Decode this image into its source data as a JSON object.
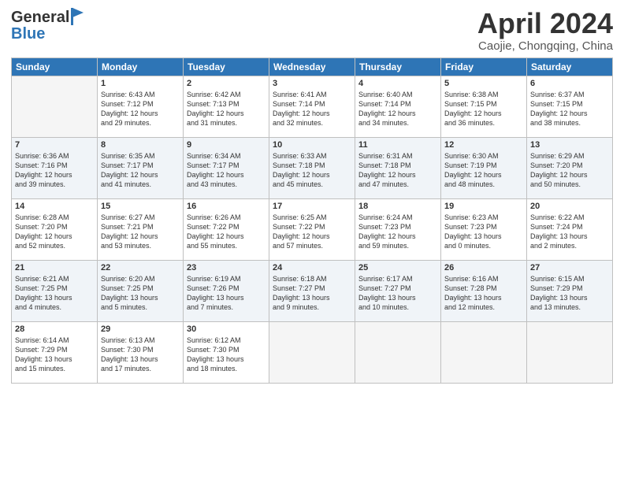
{
  "header": {
    "logo_line1": "General",
    "logo_line2": "Blue",
    "title": "April 2024",
    "subtitle": "Caojie, Chongqing, China"
  },
  "columns": [
    "Sunday",
    "Monday",
    "Tuesday",
    "Wednesday",
    "Thursday",
    "Friday",
    "Saturday"
  ],
  "weeks": [
    {
      "days": [
        {
          "num": "",
          "info": ""
        },
        {
          "num": "1",
          "info": "Sunrise: 6:43 AM\nSunset: 7:12 PM\nDaylight: 12 hours\nand 29 minutes."
        },
        {
          "num": "2",
          "info": "Sunrise: 6:42 AM\nSunset: 7:13 PM\nDaylight: 12 hours\nand 31 minutes."
        },
        {
          "num": "3",
          "info": "Sunrise: 6:41 AM\nSunset: 7:14 PM\nDaylight: 12 hours\nand 32 minutes."
        },
        {
          "num": "4",
          "info": "Sunrise: 6:40 AM\nSunset: 7:14 PM\nDaylight: 12 hours\nand 34 minutes."
        },
        {
          "num": "5",
          "info": "Sunrise: 6:38 AM\nSunset: 7:15 PM\nDaylight: 12 hours\nand 36 minutes."
        },
        {
          "num": "6",
          "info": "Sunrise: 6:37 AM\nSunset: 7:15 PM\nDaylight: 12 hours\nand 38 minutes."
        }
      ]
    },
    {
      "days": [
        {
          "num": "7",
          "info": "Sunrise: 6:36 AM\nSunset: 7:16 PM\nDaylight: 12 hours\nand 39 minutes."
        },
        {
          "num": "8",
          "info": "Sunrise: 6:35 AM\nSunset: 7:17 PM\nDaylight: 12 hours\nand 41 minutes."
        },
        {
          "num": "9",
          "info": "Sunrise: 6:34 AM\nSunset: 7:17 PM\nDaylight: 12 hours\nand 43 minutes."
        },
        {
          "num": "10",
          "info": "Sunrise: 6:33 AM\nSunset: 7:18 PM\nDaylight: 12 hours\nand 45 minutes."
        },
        {
          "num": "11",
          "info": "Sunrise: 6:31 AM\nSunset: 7:18 PM\nDaylight: 12 hours\nand 47 minutes."
        },
        {
          "num": "12",
          "info": "Sunrise: 6:30 AM\nSunset: 7:19 PM\nDaylight: 12 hours\nand 48 minutes."
        },
        {
          "num": "13",
          "info": "Sunrise: 6:29 AM\nSunset: 7:20 PM\nDaylight: 12 hours\nand 50 minutes."
        }
      ]
    },
    {
      "days": [
        {
          "num": "14",
          "info": "Sunrise: 6:28 AM\nSunset: 7:20 PM\nDaylight: 12 hours\nand 52 minutes."
        },
        {
          "num": "15",
          "info": "Sunrise: 6:27 AM\nSunset: 7:21 PM\nDaylight: 12 hours\nand 53 minutes."
        },
        {
          "num": "16",
          "info": "Sunrise: 6:26 AM\nSunset: 7:22 PM\nDaylight: 12 hours\nand 55 minutes."
        },
        {
          "num": "17",
          "info": "Sunrise: 6:25 AM\nSunset: 7:22 PM\nDaylight: 12 hours\nand 57 minutes."
        },
        {
          "num": "18",
          "info": "Sunrise: 6:24 AM\nSunset: 7:23 PM\nDaylight: 12 hours\nand 59 minutes."
        },
        {
          "num": "19",
          "info": "Sunrise: 6:23 AM\nSunset: 7:23 PM\nDaylight: 13 hours\nand 0 minutes."
        },
        {
          "num": "20",
          "info": "Sunrise: 6:22 AM\nSunset: 7:24 PM\nDaylight: 13 hours\nand 2 minutes."
        }
      ]
    },
    {
      "days": [
        {
          "num": "21",
          "info": "Sunrise: 6:21 AM\nSunset: 7:25 PM\nDaylight: 13 hours\nand 4 minutes."
        },
        {
          "num": "22",
          "info": "Sunrise: 6:20 AM\nSunset: 7:25 PM\nDaylight: 13 hours\nand 5 minutes."
        },
        {
          "num": "23",
          "info": "Sunrise: 6:19 AM\nSunset: 7:26 PM\nDaylight: 13 hours\nand 7 minutes."
        },
        {
          "num": "24",
          "info": "Sunrise: 6:18 AM\nSunset: 7:27 PM\nDaylight: 13 hours\nand 9 minutes."
        },
        {
          "num": "25",
          "info": "Sunrise: 6:17 AM\nSunset: 7:27 PM\nDaylight: 13 hours\nand 10 minutes."
        },
        {
          "num": "26",
          "info": "Sunrise: 6:16 AM\nSunset: 7:28 PM\nDaylight: 13 hours\nand 12 minutes."
        },
        {
          "num": "27",
          "info": "Sunrise: 6:15 AM\nSunset: 7:29 PM\nDaylight: 13 hours\nand 13 minutes."
        }
      ]
    },
    {
      "days": [
        {
          "num": "28",
          "info": "Sunrise: 6:14 AM\nSunset: 7:29 PM\nDaylight: 13 hours\nand 15 minutes."
        },
        {
          "num": "29",
          "info": "Sunrise: 6:13 AM\nSunset: 7:30 PM\nDaylight: 13 hours\nand 17 minutes."
        },
        {
          "num": "30",
          "info": "Sunrise: 6:12 AM\nSunset: 7:30 PM\nDaylight: 13 hours\nand 18 minutes."
        },
        {
          "num": "",
          "info": ""
        },
        {
          "num": "",
          "info": ""
        },
        {
          "num": "",
          "info": ""
        },
        {
          "num": "",
          "info": ""
        }
      ]
    }
  ]
}
